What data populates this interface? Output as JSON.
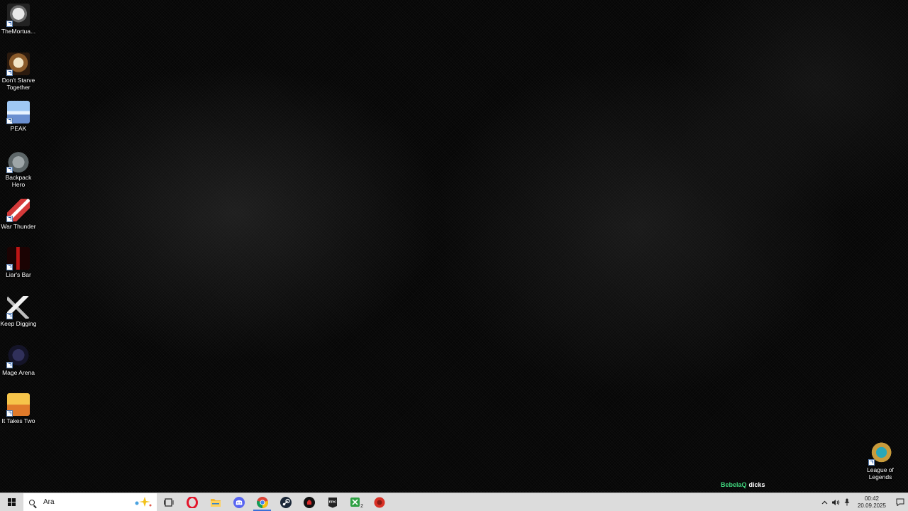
{
  "desktop": {
    "icons": [
      {
        "id": "mortuary",
        "label": "TheMortua...",
        "icon": "mortuary-assistant-icon"
      },
      {
        "id": "dst",
        "label": "Don't Starve Together",
        "icon": "dont-starve-icon"
      },
      {
        "id": "peak",
        "label": "PEAK",
        "icon": "peak-icon"
      },
      {
        "id": "backpack",
        "label": "Backpack Hero",
        "icon": "backpack-hero-icon"
      },
      {
        "id": "warthunder",
        "label": "War Thunder",
        "icon": "war-thunder-icon"
      },
      {
        "id": "liars",
        "label": "Liar's Bar",
        "icon": "liars-bar-icon"
      },
      {
        "id": "digging",
        "label": "Keep Digging",
        "icon": "pickaxe-icon"
      },
      {
        "id": "mage",
        "label": "Mage Arena",
        "icon": "mage-arena-icon"
      },
      {
        "id": "ittakestwo",
        "label": "It Takes Two",
        "icon": "it-takes-two-icon"
      },
      {
        "id": "lol",
        "label": "League of Legends",
        "icon": "league-of-legends-icon"
      }
    ],
    "watermark": {
      "name": "BebelaQ",
      "text": "dicks",
      "name_color": "#3fd47c"
    }
  },
  "taskbar": {
    "search_placeholder": "Ara",
    "apps": [
      {
        "name": "task-view",
        "icon": "task-view-icon"
      },
      {
        "name": "opera",
        "icon": "opera-icon",
        "color": "#e3142a"
      },
      {
        "name": "file-explorer",
        "icon": "folder-icon",
        "color": "#f2b632"
      },
      {
        "name": "discord",
        "icon": "discord-icon",
        "color": "#5865f2"
      },
      {
        "name": "chrome",
        "icon": "chrome-icon",
        "active": true
      },
      {
        "name": "steam",
        "icon": "steam-icon",
        "color": "#1b2838"
      },
      {
        "name": "game-app",
        "icon": "game-app-icon",
        "color": "#111111"
      },
      {
        "name": "epic-games",
        "icon": "epic-games-icon",
        "color": "#222222"
      },
      {
        "name": "xbox",
        "icon": "xbox-icon",
        "color": "#2ea043",
        "badge": "2"
      },
      {
        "name": "red-app",
        "icon": "red-app-icon",
        "color": "#d93025"
      }
    ],
    "clock": {
      "time": "00:42",
      "date": "20.09.2025"
    }
  }
}
